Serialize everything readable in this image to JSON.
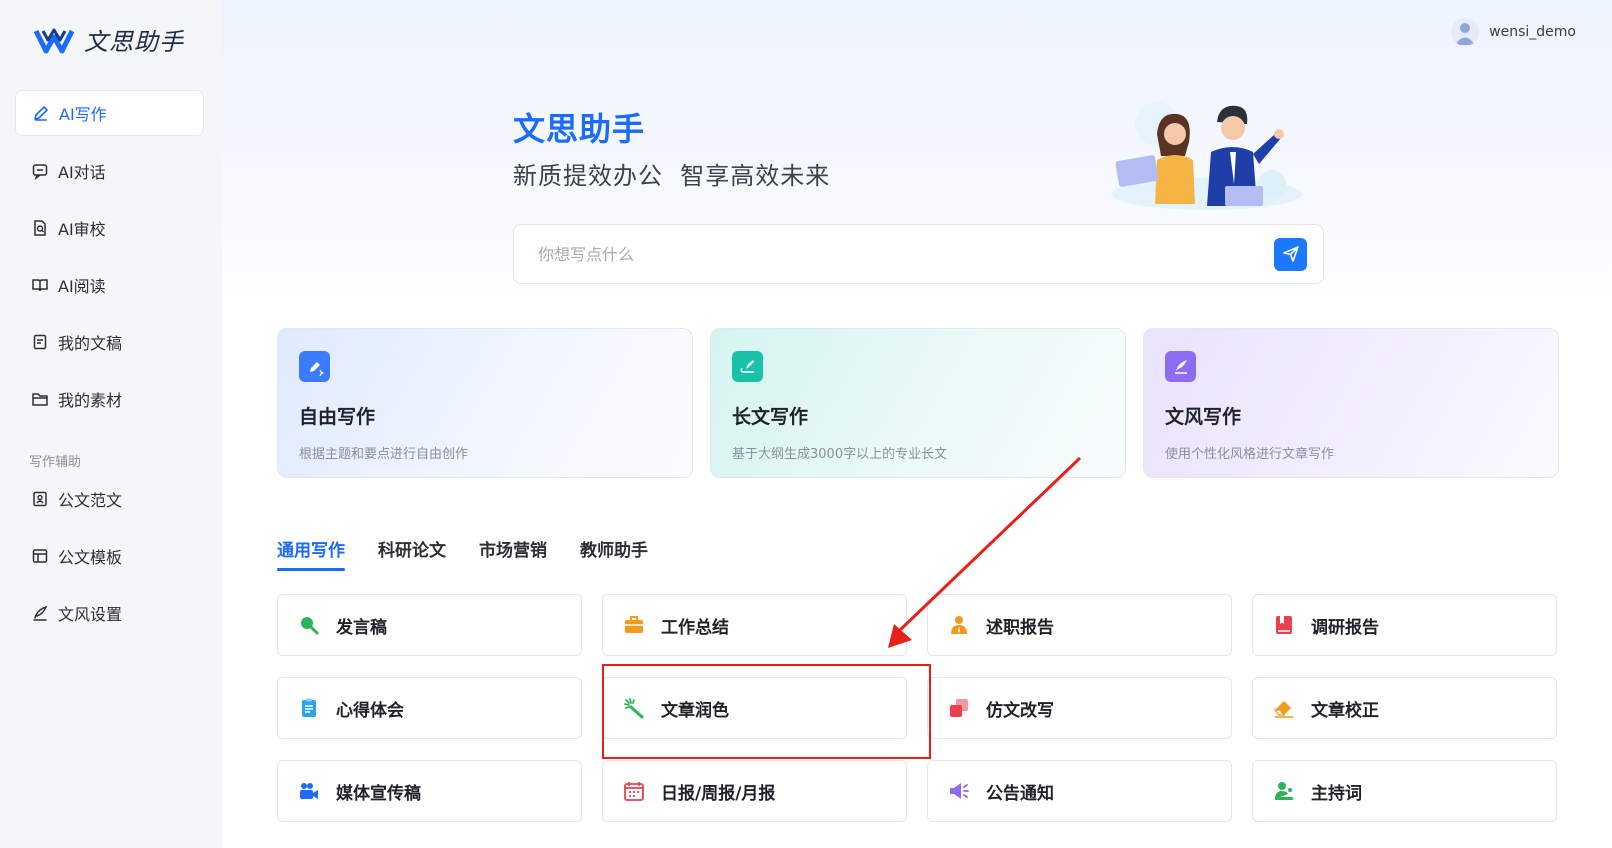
{
  "brand": {
    "name": "文思助手"
  },
  "sidebar": {
    "items": [
      {
        "label": "AI写作",
        "icon": "pen-icon",
        "active": true
      },
      {
        "label": "AI对话",
        "icon": "chat-icon"
      },
      {
        "label": "AI审校",
        "icon": "review-icon"
      },
      {
        "label": "AI阅读",
        "icon": "book-icon"
      },
      {
        "label": "我的文稿",
        "icon": "document-icon"
      },
      {
        "label": "我的素材",
        "icon": "folder-icon"
      }
    ],
    "section_label": "写作辅助",
    "sub_items": [
      {
        "label": "公文范文",
        "icon": "sample-doc-icon"
      },
      {
        "label": "公文模板",
        "icon": "template-icon"
      },
      {
        "label": "文风设置",
        "icon": "quill-icon"
      }
    ]
  },
  "user": {
    "name": "wensi_demo"
  },
  "hero": {
    "title": "文思助手",
    "subtitle": "新质提效办公  智享高效未来"
  },
  "search": {
    "placeholder": "你想写点什么"
  },
  "modes": [
    {
      "title": "自由写作",
      "desc": "根据主题和要点进行自由创作",
      "icon": "edit-sparkle-icon",
      "color": "#3a7bff"
    },
    {
      "title": "长文写作",
      "desc": "基于大纲生成3000字以上的专业长文",
      "icon": "long-text-icon",
      "color": "#18c2a8"
    },
    {
      "title": "文风写作",
      "desc": "使用个性化风格进行文章写作",
      "icon": "style-pen-icon",
      "color": "#8c6cf2"
    }
  ],
  "tabs": [
    {
      "label": "通用写作",
      "active": true
    },
    {
      "label": "科研论文"
    },
    {
      "label": "市场营销"
    },
    {
      "label": "教师助手"
    }
  ],
  "templates": [
    {
      "label": "发言稿",
      "icon": "speech-icon",
      "color": "#2fb35a"
    },
    {
      "label": "工作总结",
      "icon": "briefcase-icon",
      "color": "#f39a1c"
    },
    {
      "label": "述职报告",
      "icon": "report-person-icon",
      "color": "#f39a1c"
    },
    {
      "label": "调研报告",
      "icon": "research-book-icon",
      "color": "#e8414b"
    },
    {
      "label": "心得体会",
      "icon": "clipboard-icon",
      "color": "#2aa5e8"
    },
    {
      "label": "文章润色",
      "icon": "magic-wand-icon",
      "color": "#2fb35a"
    },
    {
      "label": "仿文改写",
      "icon": "copy-rewrite-icon",
      "color": "#e8414b"
    },
    {
      "label": "文章校正",
      "icon": "eraser-icon",
      "color": "#f39a1c"
    },
    {
      "label": "媒体宣传稿",
      "icon": "video-camera-icon",
      "color": "#1b6bff"
    },
    {
      "label": "日报/周报/月报",
      "icon": "calendar-icon",
      "color": "#e8414b"
    },
    {
      "label": "公告通知",
      "icon": "megaphone-icon",
      "color": "#8c6cf2"
    },
    {
      "label": "主持词",
      "icon": "host-person-icon",
      "color": "#2fb35a"
    }
  ],
  "colors": {
    "accent": "#1b6bff",
    "annotation": "#e8201a"
  }
}
